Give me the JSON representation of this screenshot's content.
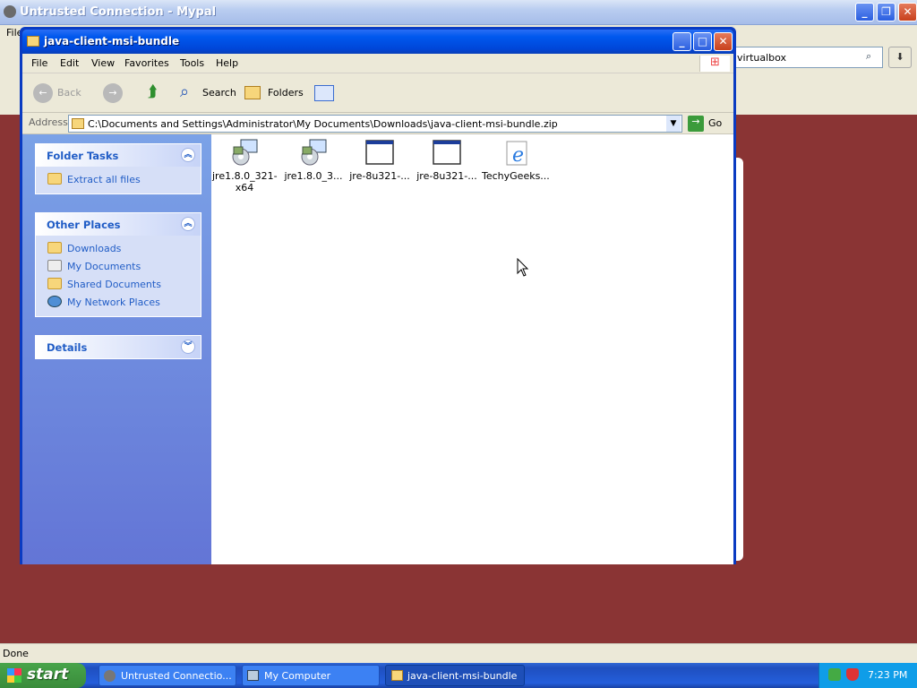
{
  "browser": {
    "title": "Untrusted Connection - Mypal",
    "menu_file": "File",
    "search_value": "virtualbox",
    "status": "Done"
  },
  "explorer": {
    "title": "java-client-msi-bundle",
    "menu": [
      "File",
      "Edit",
      "View",
      "Favorites",
      "Tools",
      "Help"
    ],
    "toolbar": {
      "back": "Back",
      "search": "Search",
      "folders": "Folders"
    },
    "address_label": "Address",
    "address_value": "C:\\Documents and Settings\\Administrator\\My Documents\\Downloads\\java-client-msi-bundle.zip",
    "go": "Go",
    "folder_tasks": {
      "title": "Folder Tasks",
      "items": [
        "Extract all files"
      ]
    },
    "other_places": {
      "title": "Other Places",
      "items": [
        "Downloads",
        "My Documents",
        "Shared Documents",
        "My Network Places"
      ]
    },
    "details": {
      "title": "Details"
    },
    "files": [
      {
        "name": "jre1.8.0_321-x64",
        "icon": "installer-icon"
      },
      {
        "name": "jre1.8.0_3...",
        "icon": "installer-icon"
      },
      {
        "name": "jre-8u321-...",
        "icon": "window-icon"
      },
      {
        "name": "jre-8u321-...",
        "icon": "window-icon"
      },
      {
        "name": "TechyGeeks...",
        "icon": "ie-icon"
      }
    ]
  },
  "taskbar": {
    "start": "start",
    "buttons": [
      "Untrusted Connectio...",
      "My Computer",
      "java-client-msi-bundle"
    ],
    "time": "7:23 PM"
  }
}
